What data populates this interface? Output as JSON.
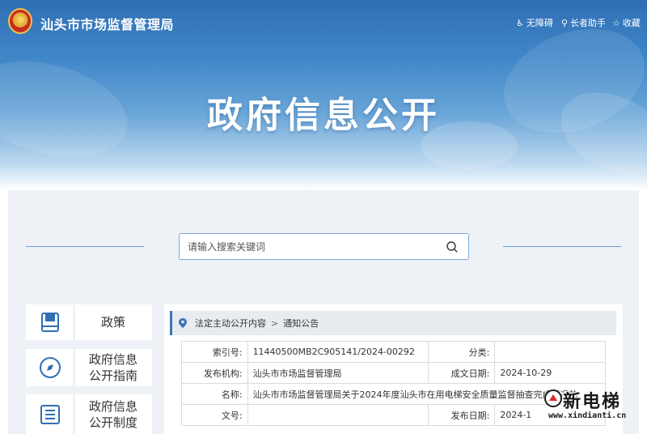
{
  "header": {
    "site_title": "汕头市市场监督管理局",
    "utilities": [
      {
        "label": "无障碍",
        "icon": "accessibility-icon"
      },
      {
        "label": "长者助手",
        "icon": "elder-assist-icon"
      },
      {
        "label": "收藏",
        "icon": "star-icon"
      }
    ],
    "page_heading": "政府信息公开"
  },
  "search": {
    "placeholder": "请输入搜索关键词",
    "icon": "search-icon"
  },
  "sidebar": {
    "items": [
      {
        "label": "政策",
        "icon": "book-icon"
      },
      {
        "label": "政府信息\n公开指南",
        "icon": "compass-icon"
      },
      {
        "label": "政府信息\n公开制度",
        "icon": "list-document-icon"
      }
    ]
  },
  "breadcrumb": {
    "items": [
      "法定主动公开内容",
      "通知公告"
    ],
    "separator": ">"
  },
  "meta_table": {
    "index_label": "索引号:",
    "index_value": "11440500MB2C905141/2024-00292",
    "category_label": "分类:",
    "category_value": "",
    "publisher_label": "发布机构:",
    "publisher_value": "汕头市市场监督管理局",
    "written_date_label": "成文日期:",
    "written_date_value": "2024-10-29",
    "name_label": "名称:",
    "name_value": "汕头市市场监督管理局关于2024年度汕头市在用电梯安全质量监督抽查完成情况的",
    "doc_no_label": "文号:",
    "doc_no_value": "",
    "publish_date_label": "发布日期:",
    "publish_date_value": "2024-1"
  },
  "watermark": {
    "text": "新电梯",
    "url": "www.xindianti.cn"
  },
  "colors": {
    "primary_blue": "#3a74b8",
    "panel_gray": "#eef1f5"
  }
}
